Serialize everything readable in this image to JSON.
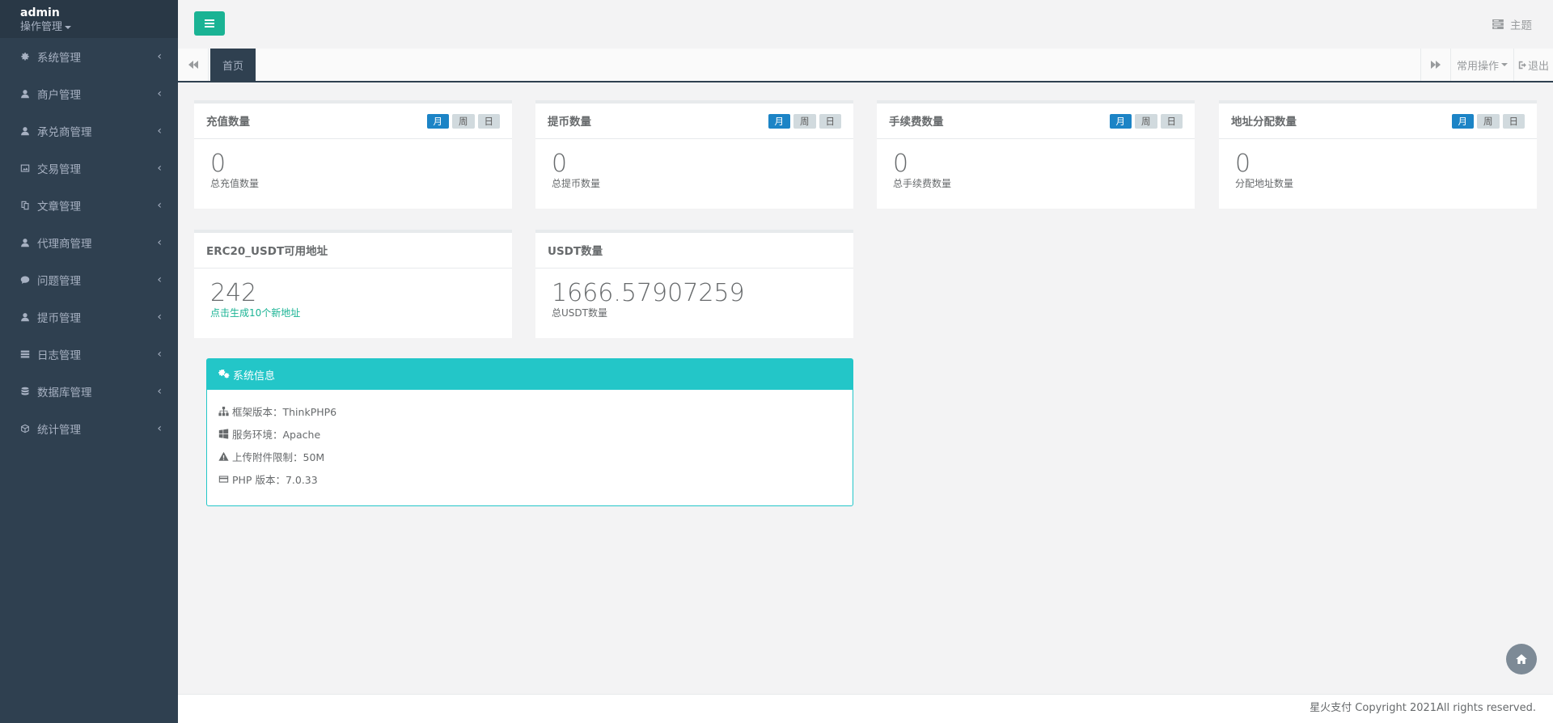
{
  "profile": {
    "user": "admin",
    "role_menu": "操作管理"
  },
  "sidebar": {
    "items": [
      {
        "label": "系统管理",
        "icon": "gear-icon"
      },
      {
        "label": "商户管理",
        "icon": "user-icon"
      },
      {
        "label": "承兑商管理",
        "icon": "user-icon"
      },
      {
        "label": "交易管理",
        "icon": "picture-icon"
      },
      {
        "label": "文章管理",
        "icon": "copy-icon"
      },
      {
        "label": "代理商管理",
        "icon": "user-icon"
      },
      {
        "label": "问题管理",
        "icon": "comment-icon"
      },
      {
        "label": "提币管理",
        "icon": "user-icon"
      },
      {
        "label": "日志管理",
        "icon": "list-icon"
      },
      {
        "label": "数据库管理",
        "icon": "database-icon"
      },
      {
        "label": "统计管理",
        "icon": "cube-icon"
      }
    ],
    "chevron": "‹"
  },
  "topbar": {
    "theme_label": "主题"
  },
  "tabs": {
    "active_tab": "首页",
    "common_ops": "常用操作",
    "logout": "退出"
  },
  "widgets": [
    {
      "title": "充值数量",
      "value": "0",
      "caption": "总充值数量",
      "pills": [
        "月",
        "周",
        "日"
      ]
    },
    {
      "title": "提币数量",
      "value": "0",
      "caption": "总提币数量",
      "pills": [
        "月",
        "周",
        "日"
      ]
    },
    {
      "title": "手续费数量",
      "value": "0",
      "caption": "总手续费数量",
      "pills": [
        "月",
        "周",
        "日"
      ]
    },
    {
      "title": "地址分配数量",
      "value": "0",
      "caption": "分配地址数量",
      "pills": [
        "月",
        "周",
        "日"
      ]
    },
    {
      "title": "ERC20_USDT可用地址",
      "value": "242",
      "caption": "点击生成10个新地址"
    },
    {
      "title": "USDT数量",
      "value": "1666.57907259",
      "caption": "总USDT数量"
    }
  ],
  "system_info": {
    "title": "系统信息",
    "rows": [
      {
        "label": "框架版本：ThinkPHP6",
        "icon": "sitemap-icon"
      },
      {
        "label": "服务环境：Apache",
        "icon": "windows-icon"
      },
      {
        "label": "上传附件限制：50M",
        "icon": "warning-icon"
      },
      {
        "label": "PHP 版本：7.0.33",
        "icon": "credit-card-icon"
      }
    ]
  },
  "footer": {
    "text": "星火支付 Copyright 2021All rights reserved."
  },
  "colors": {
    "sidebar": "#2f4050",
    "accent_green": "#1ab394",
    "accent_blue": "#1c84c6",
    "info_cyan": "#23c6c8"
  }
}
